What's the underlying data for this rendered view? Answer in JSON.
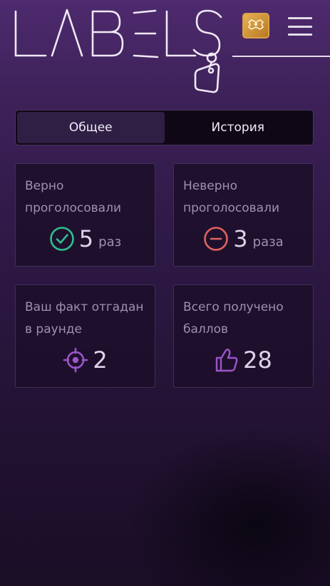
{
  "header": {
    "logo_text": "LABELS",
    "logo_icon": "tag-icon",
    "avatar_icon": "avatar-badge",
    "menu_icon": "hamburger-icon"
  },
  "tabs": [
    {
      "label": "Общее",
      "active": true
    },
    {
      "label": "История",
      "active": false
    }
  ],
  "stats": [
    {
      "label": "Верно проголосовали",
      "icon": "check-circle-icon",
      "value": "5",
      "unit": "раз",
      "color": "#2fbf8f"
    },
    {
      "label": "Неверно проголосовали",
      "icon": "minus-circle-icon",
      "value": "3",
      "unit": "раза",
      "color": "#e0625e"
    },
    {
      "label": "Ваш факт отгадан в раунде",
      "icon": "crosshair-icon",
      "value": "2",
      "unit": "",
      "color": "#9b55c9"
    },
    {
      "label": "Всего получено баллов",
      "icon": "thumbs-up-icon",
      "value": "28",
      "unit": "",
      "color": "#9b55c9"
    }
  ]
}
